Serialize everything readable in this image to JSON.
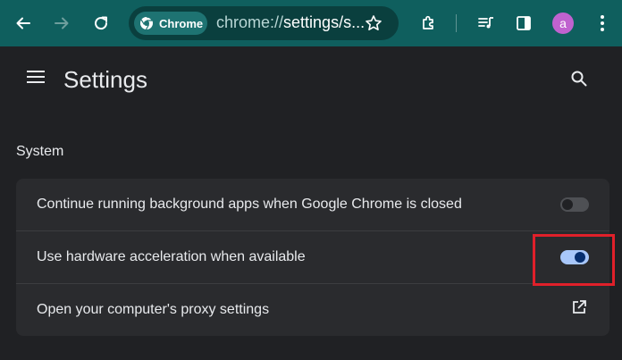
{
  "browser": {
    "chip_label": "Chrome",
    "url_prefix": "chrome://",
    "url_host": "settings/s...",
    "avatar_letter": "a"
  },
  "header": {
    "title": "Settings"
  },
  "system": {
    "section_title": "System",
    "rows": [
      {
        "label": "Continue running background apps when Google Chrome is closed",
        "control": "toggle",
        "enabled": false
      },
      {
        "label": "Use hardware acceleration when available",
        "control": "toggle",
        "enabled": true
      },
      {
        "label": "Open your computer's proxy settings",
        "control": "external-link"
      }
    ]
  },
  "colors": {
    "toolbar": "#0f5f5e",
    "page_bg": "#202124",
    "card_bg": "#2a2b2e",
    "toggle_on": "#a8c7fa",
    "highlight": "#e0202a"
  }
}
